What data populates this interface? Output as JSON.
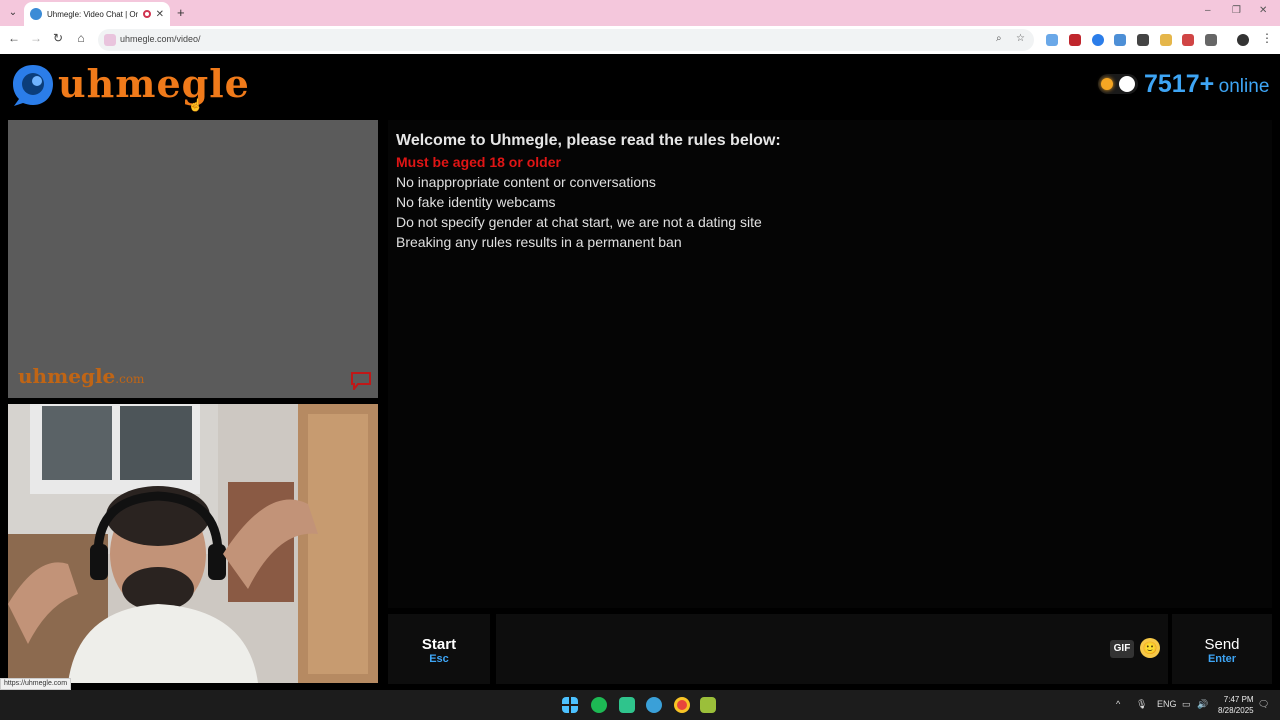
{
  "browser": {
    "tab_title": "Uhmegle: Video Chat | Om",
    "tab_close": "✕",
    "new_tab": "+",
    "url": "uhmegle.com/video/",
    "window_controls": [
      "–",
      "❐",
      "✕"
    ]
  },
  "site": {
    "logo_text": "uhmegle",
    "online_count": "7517+",
    "online_label": "online",
    "watermark_main": "uhmegle",
    "watermark_suffix": ".com"
  },
  "rules": {
    "heading": "Welcome to Uhmegle, please read the rules below:",
    "age": "Must be aged 18 or older",
    "items": [
      "No inappropriate content or conversations",
      "No fake identity webcams",
      "Do not specify gender at chat start, we are not a dating site",
      "Breaking any rules results in a permanent ban"
    ]
  },
  "controls": {
    "start_label": "Start",
    "start_key": "Esc",
    "gif_label": "GIF",
    "emoji": "🙂",
    "send_label": "Send",
    "send_key": "Enter"
  },
  "status_bar_url": "https://uhmegle.com",
  "taskbar": {
    "lang": "ENG",
    "time": "7:47 PM",
    "date": "8/28/2025"
  },
  "colors": {
    "brand_orange": "#f07a1a",
    "brand_blue": "#3ea5f5",
    "rule_red": "#e01515"
  }
}
